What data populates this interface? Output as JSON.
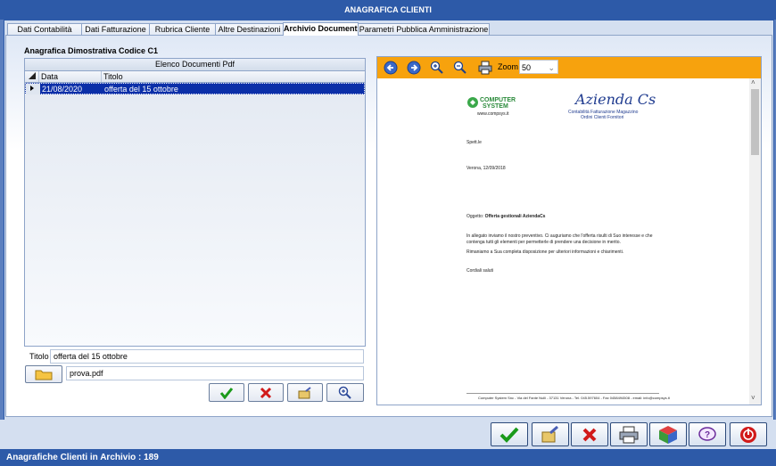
{
  "window": {
    "title": "ANAGRAFICA CLIENTI"
  },
  "tabs": [
    {
      "label": "Dati Contabilità"
    },
    {
      "label": "Dati Fatturazione"
    },
    {
      "label": "Rubrica Cliente"
    },
    {
      "label": "Altre Destinazioni"
    },
    {
      "label": "Archivio Documenti",
      "active": true
    },
    {
      "label": "Parametri Pubblica Amministrazione"
    }
  ],
  "section": {
    "heading": "Anagrafica Dimostrativa Codice C1"
  },
  "grid": {
    "title": "Elenco Documenti Pdf",
    "columns": [
      "Data",
      "Titolo"
    ],
    "rows": [
      {
        "data": "21/08/2020",
        "titolo": "offerta del 15 ottobre"
      }
    ]
  },
  "form": {
    "titolo_label": "Titolo",
    "titolo_value": "offerta del 15 ottobre",
    "file_value": "prova.pdf"
  },
  "pdf_viewer": {
    "zoom_label": "Zoom",
    "zoom_value": "50",
    "document": {
      "logo_left_line1": "COMPUTER",
      "logo_left_line2": "SYSTEM",
      "logo_left_url": "www.compsys.it",
      "logo_right_title": "Azienda Cs",
      "logo_right_sub1": "Contabilità Fatturazione Magazzino",
      "logo_right_sub2": "Ordini Clienti Fornitori",
      "greeting": "Spett.le",
      "date_line": "Verona, 12/09/2018",
      "subject_prefix": "Oggetto:",
      "subject": "Offerta gestionali AziendaCs",
      "body1": "In allegato inviamo il nostro preventivo. Ci auguriamo che l'offerta risulti di Suo interesse e che",
      "body2": "contenga tutti gli elementi per permetterle di prendere una decisione in merito.",
      "body3": "Rimaniamo a Sua completa disposizione per ulteriori informazioni e chiarimenti.",
      "closing": "Cordiali saluti",
      "footer": "Computer System Snc - Via del Fante Nulli - 37131 Verona - Tel. 045.597604 - Fax 0458494508 - email: info@compsys.it"
    }
  },
  "status": {
    "text": "Anagrafiche Clienti in Archivio :  189"
  },
  "colors": {
    "accent": "#2d5aa8",
    "toolbar": "#f7a20d",
    "selection": "#0b2fa8"
  }
}
